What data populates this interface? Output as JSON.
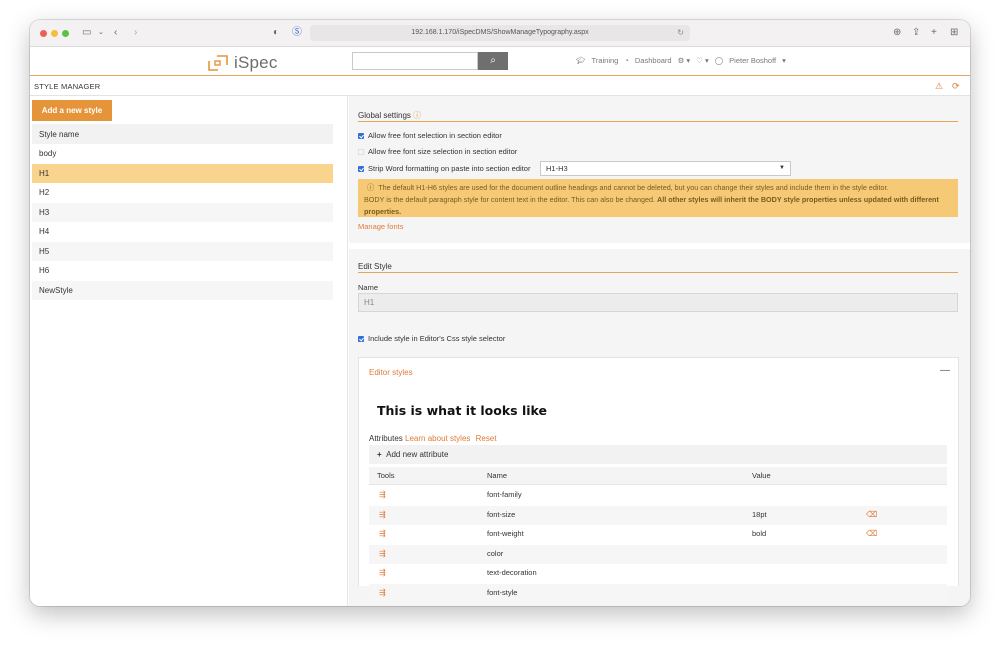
{
  "browser": {
    "url": "192.168.1.170/iSpecDMS/ShowManageTypography.aspx"
  },
  "header": {
    "logo_text": "iSpec",
    "search_placeholder": "",
    "nav": {
      "training": "Training",
      "dashboard": "Dashboard",
      "user": "Pieter Boshoff"
    }
  },
  "page": {
    "title": "STYLE MANAGER"
  },
  "left": {
    "add_button": "Add a new style",
    "column_header": "Style name",
    "styles": [
      "body",
      "H1",
      "H2",
      "H3",
      "H4",
      "H5",
      "H6",
      "NewStyle"
    ],
    "selected": "H1"
  },
  "global_settings": {
    "title": "Global settings",
    "allow_font": "Allow free font selection in section editor",
    "allow_font_size": "Allow free font size selection in section editor",
    "strip_word": "Strip Word formatting on paste into section editor",
    "strip_select_value": "H1-H3",
    "alert_line1": "The default H1-H6 styles are used for the document outline headings and cannot be deleted, but you can change their styles and include them in the style editor.",
    "alert_line2": "BODY is the default paragraph style for content text in the editor. This can also be changed.",
    "alert_bold": "All other styles will inherit the BODY style properties unless updated with different properties.",
    "manage_fonts": "Manage fonts"
  },
  "edit_style": {
    "title": "Edit Style",
    "name_label": "Name",
    "name_value": "H1",
    "include_label": "Include style in Editor's Css style selector",
    "panel_title": "Editor styles",
    "preview_text": "This is what it looks like",
    "attributes_label": "Attributes",
    "learn_link": "Learn about styles",
    "reset_link": "Reset",
    "add_attribute": "Add new attribute",
    "columns": {
      "tools": "Tools",
      "name": "Name",
      "value": "Value"
    },
    "rows": [
      {
        "name": "font-family",
        "value": ""
      },
      {
        "name": "font-size",
        "value": "18pt"
      },
      {
        "name": "font-weight",
        "value": "bold"
      },
      {
        "name": "color",
        "value": ""
      },
      {
        "name": "text-decoration",
        "value": ""
      },
      {
        "name": "font-style",
        "value": ""
      }
    ]
  },
  "colors": {
    "accent": "#e6943a",
    "selected_row": "#f8d48f",
    "alert_bg": "#f6c977"
  }
}
